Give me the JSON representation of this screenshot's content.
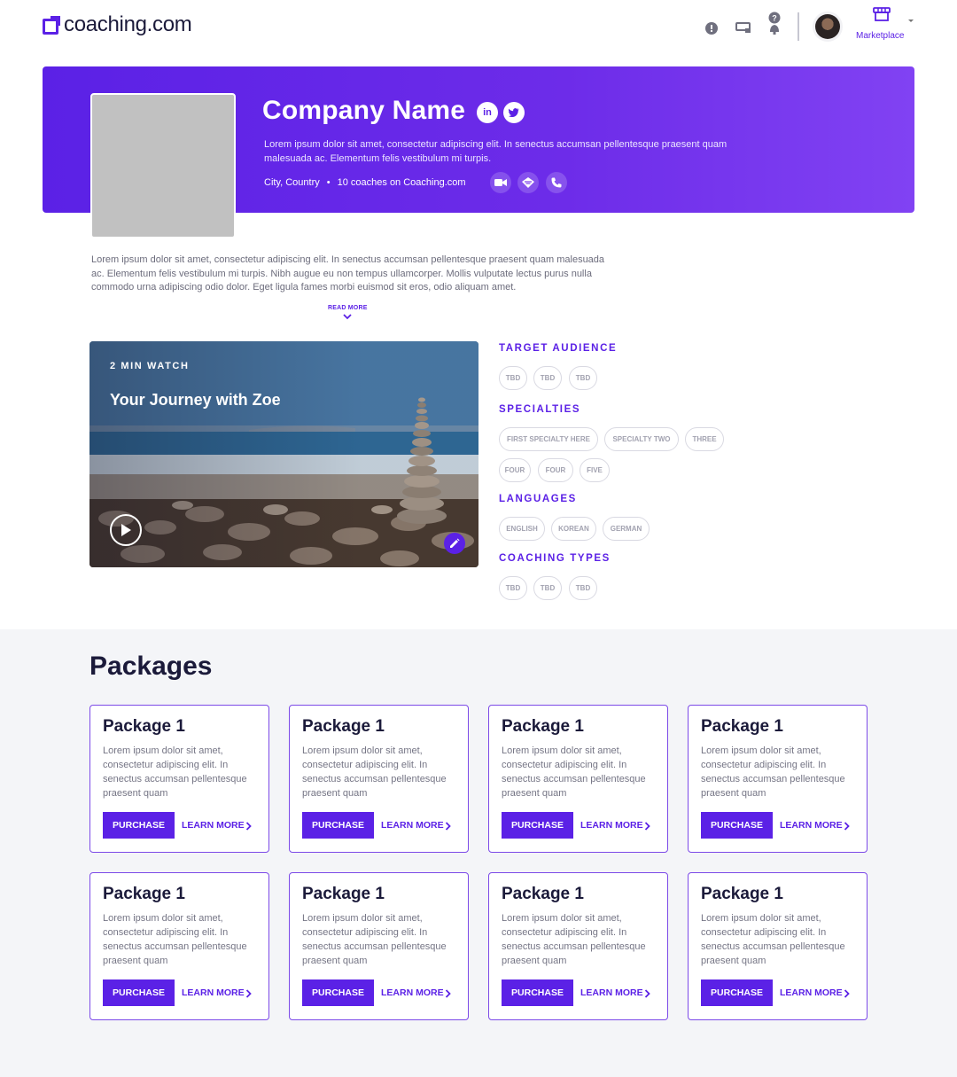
{
  "header": {
    "brand": "coaching.com",
    "marketplace_label": "Marketplace",
    "icons": [
      "info-icon",
      "messages-icon",
      "help-icon",
      "avatar",
      "marketplace-icon"
    ]
  },
  "hero": {
    "company_name": "Company Name",
    "social": [
      "in",
      "t"
    ],
    "description": "Lorem ipsum dolor sit amet, consectetur adipiscing elit. In senectus accumsan pellentesque praesent quam malesuada ac. Elementum felis vestibulum mi turpis.",
    "location": "City, Country",
    "separator": "•",
    "coaches": "10 coaches on Coaching.com"
  },
  "about": {
    "text": "Lorem ipsum dolor sit amet, consectetur adipiscing elit. In senectus accumsan pellentesque praesent quam malesuada ac. Elementum felis vestibulum mi turpis. Nibh augue eu non tempus ullamcorper. Mollis vulputate lectus purus nulla commodo urna adipiscing odio dolor. Eget ligula fames morbi euismod sit eros, odio aliquam amet.",
    "read_more": "READ MORE"
  },
  "video": {
    "eyebrow": "2 MIN WATCH",
    "title": "Your Journey with Zoe"
  },
  "tag_groups": {
    "target_audience": {
      "title": "TARGET AUDIENCE",
      "tags": [
        "TBD",
        "TBD",
        "TBD"
      ]
    },
    "specialties": {
      "title": "SPECIALTIES",
      "tags": [
        "FIRST SPECIALTY HERE",
        "SPECIALTY TWO",
        "THREE",
        "FOUR",
        "FOUR",
        "FIVE"
      ]
    },
    "languages": {
      "title": "LANGUAGES",
      "tags": [
        "ENGLISH",
        "KOREAN",
        "GERMAN"
      ]
    },
    "coaching_types": {
      "title": "COACHING TYPES",
      "tags": [
        "TBD",
        "TBD",
        "TBD"
      ]
    }
  },
  "packages": {
    "title": "Packages",
    "items": [
      {
        "name": "Package 1",
        "desc": "Lorem ipsum dolor sit amet, consectetur adipiscing elit. In senectus accumsan pellentesque praesent quam",
        "purchase": "PURCHASE",
        "learn": "LEARN MORE"
      },
      {
        "name": "Package 1",
        "desc": "Lorem ipsum dolor sit amet, consectetur adipiscing elit. In senectus accumsan pellentesque praesent quam",
        "purchase": "PURCHASE",
        "learn": "LEARN MORE"
      },
      {
        "name": "Package 1",
        "desc": "Lorem ipsum dolor sit amet, consectetur adipiscing elit. In senectus accumsan pellentesque praesent quam",
        "purchase": "PURCHASE",
        "learn": "LEARN MORE"
      },
      {
        "name": "Package 1",
        "desc": "Lorem ipsum dolor sit amet, consectetur adipiscing elit. In senectus accumsan pellentesque praesent quam",
        "purchase": "PURCHASE",
        "learn": "LEARN MORE"
      },
      {
        "name": "Package 1",
        "desc": "Lorem ipsum dolor sit amet, consectetur adipiscing elit. In senectus accumsan pellentesque praesent quam",
        "purchase": "PURCHASE",
        "learn": "LEARN MORE"
      },
      {
        "name": "Package 1",
        "desc": "Lorem ipsum dolor sit amet, consectetur adipiscing elit. In senectus accumsan pellentesque praesent quam",
        "purchase": "PURCHASE",
        "learn": "LEARN MORE"
      },
      {
        "name": "Package 1",
        "desc": "Lorem ipsum dolor sit amet, consectetur adipiscing elit. In senectus accumsan pellentesque praesent quam",
        "purchase": "PURCHASE",
        "learn": "LEARN MORE"
      },
      {
        "name": "Package 1",
        "desc": "Lorem ipsum dolor sit amet, consectetur adipiscing elit. In senectus accumsan pellentesque praesent quam",
        "purchase": "PURCHASE",
        "learn": "LEARN MORE"
      }
    ]
  },
  "colors": {
    "brand": "#5b21e6",
    "hero_gradient_end": "#8142f3",
    "packages_bg": "#f4f5f8"
  }
}
